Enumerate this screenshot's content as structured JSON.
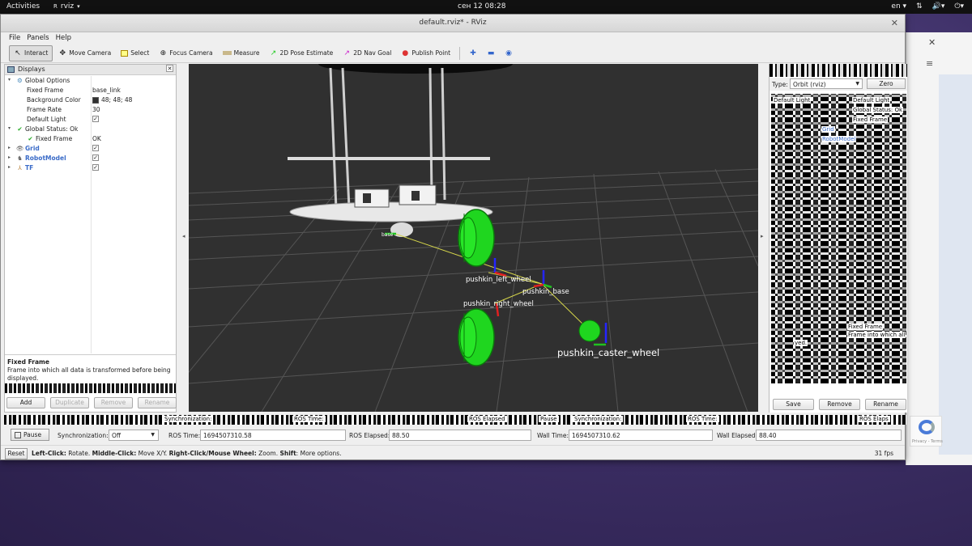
{
  "topbar": {
    "activities": "Activities",
    "app_name": "rviz",
    "clock": "сен 12  08:28",
    "language": "en"
  },
  "window": {
    "title": "default.rviz* - RViz"
  },
  "menu": [
    "File",
    "Panels",
    "Help"
  ],
  "toolbar": {
    "tools": [
      {
        "label": "Interact",
        "icon": "cursor-icon",
        "active": true
      },
      {
        "label": "Move Camera",
        "icon": "move-camera-icon"
      },
      {
        "label": "Select",
        "icon": "select-icon"
      },
      {
        "label": "Focus Camera",
        "icon": "focus-camera-icon"
      },
      {
        "label": "Measure",
        "icon": "ruler-icon"
      },
      {
        "label": "2D Pose Estimate",
        "icon": "pose-estimate-icon"
      },
      {
        "label": "2D Nav Goal",
        "icon": "nav-goal-icon"
      },
      {
        "label": "Publish Point",
        "icon": "map-pin-icon"
      }
    ]
  },
  "displays": {
    "title": "Displays",
    "global_options": {
      "label": "Global Options",
      "fixed_frame_label": "Fixed Frame",
      "fixed_frame_value": "base_link",
      "bg_color_label": "Background Color",
      "bg_color_value": "48; 48; 48",
      "bg_color_hex": "#303030",
      "frame_rate_label": "Frame Rate",
      "frame_rate_value": "30",
      "default_light_label": "Default Light"
    },
    "global_status": {
      "label": "Global Status: Ok",
      "fixed_frame_label": "Fixed Frame",
      "fixed_frame_value": "OK"
    },
    "items": [
      {
        "label": "Grid",
        "icon": "grid-icon"
      },
      {
        "label": "RobotModel",
        "icon": "robot-model-icon"
      },
      {
        "label": "TF",
        "icon": "tf-icon"
      }
    ],
    "description": {
      "title": "Fixed Frame",
      "text": "Frame into which all data is transformed before being displayed."
    },
    "buttons": {
      "add": "Add",
      "duplicate": "Duplicate",
      "remove": "Remove",
      "rename": "Rename"
    }
  },
  "viewport": {
    "frames": {
      "base": "base",
      "left_wheel": "pushkin_left_wheel",
      "base_frame": "pushkin_base",
      "right_wheel": "pushkin_right_wheel",
      "caster": "pushkin_caster_wheel"
    }
  },
  "views": {
    "type_label": "Type:",
    "type_value": "Orbit (rviz)",
    "zero_button": "Zero",
    "glitched_labels": [
      "Default Light",
      "Default Light",
      "Global Status: Ok",
      "Fixed Frame",
      "Grid",
      "RobotModel",
      "Fixed Frame",
      "Frame into which all",
      "yed."
    ],
    "buttons": {
      "save": "Save",
      "remove": "Remove",
      "rename": "Rename"
    }
  },
  "time": {
    "pause_label": "Pause",
    "sync_label": "Synchronization:",
    "sync_value": "Off",
    "ros_time_label": "ROS Time:",
    "ros_time_value": "1694507310.58",
    "ros_elapsed_label": "ROS Elapsed:",
    "ros_elapsed_value": "88.50",
    "wall_time_label": "Wall Time:",
    "wall_time_value": "1694507310.62",
    "wall_elapsed_label": "Wall Elapsed:",
    "wall_elapsed_value": "88.40",
    "glitch_texts": [
      "Synchronization:",
      "ROS Time:",
      "ROS Elapsed",
      "Pause",
      "Synchronization:",
      "ROS Time:",
      "ROS Elaps"
    ]
  },
  "status": {
    "reset_label": "Reset",
    "hint_left_click": "Left-Click:",
    "hint_rotate": "Rotate.",
    "hint_middle": "Middle-Click:",
    "hint_move": "Move X/Y.",
    "hint_right": "Right-Click/Mouse Wheel:",
    "hint_zoom": "Zoom.",
    "hint_shift": "Shift",
    "hint_more": "More options.",
    "fps": "31 fps"
  },
  "recaptcha": {
    "text": "Privacy - Terms"
  }
}
